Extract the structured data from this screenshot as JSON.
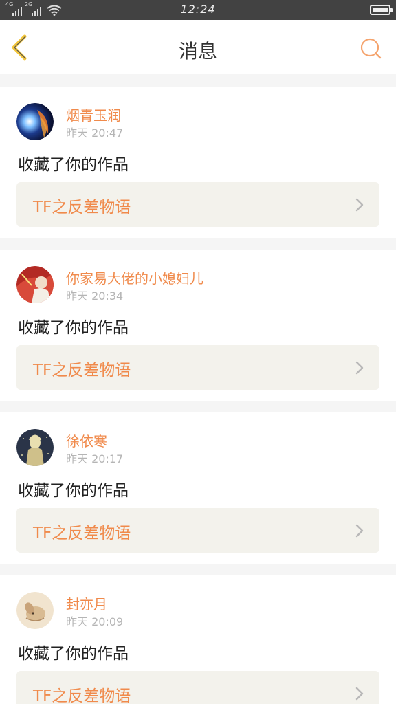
{
  "status_bar": {
    "network_1": "4G",
    "network_2": "2G",
    "time": "12:24",
    "battery_level": 1.0
  },
  "header": {
    "title": "消息",
    "back_icon": "chevron-left-icon",
    "search_icon": "search-icon"
  },
  "colors": {
    "accent": "#f08a4b",
    "back_icon": "#f3c63a",
    "card_bg": "#f3f2ec"
  },
  "messages": [
    {
      "name": "烟青玉润",
      "time": "昨天  20:47",
      "action": "收藏了你的作品",
      "work_title": "TF之反差物语",
      "avatar": "avatar-blue-orange"
    },
    {
      "name": "你家易大佬的小媳妇儿",
      "time": "昨天  20:34",
      "action": "收藏了你的作品",
      "work_title": "TF之反差物语",
      "avatar": "avatar-red-photo"
    },
    {
      "name": "徐依寒",
      "time": "昨天  20:17",
      "action": "收藏了你的作品",
      "work_title": "TF之反差物语",
      "avatar": "avatar-dark-illustration"
    },
    {
      "name": "封亦月",
      "time": "昨天  20:09",
      "action": "收藏了你的作品",
      "work_title": "TF之反差物语",
      "avatar": "avatar-beige-animal"
    }
  ]
}
